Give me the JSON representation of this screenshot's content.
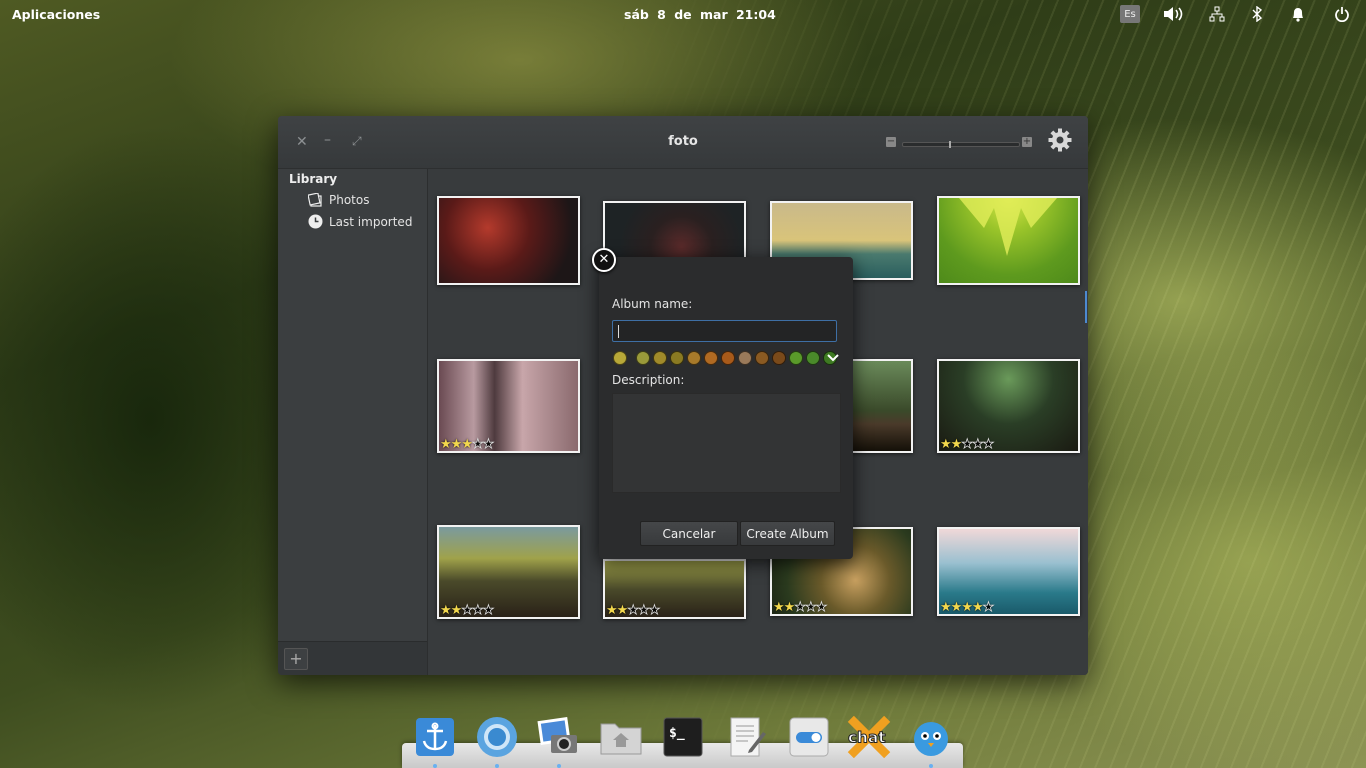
{
  "panel": {
    "applications": "Aplicaciones",
    "clock": "sáb  8 de mar   21:04",
    "lang": "Es",
    "indicators": [
      "volume-icon",
      "network-icon",
      "bluetooth-icon",
      "notifications-icon",
      "power-icon"
    ]
  },
  "window": {
    "title": "foto",
    "controls": [
      "close-icon",
      "minimize-icon",
      "maximize-icon"
    ],
    "zoom_minus": "−",
    "zoom_plus": "+",
    "zoom_level": 0.4
  },
  "sidebar": {
    "heading": "Library",
    "items": [
      {
        "label": "Photos",
        "icon": "photos-icon"
      },
      {
        "label": "Last imported",
        "icon": "clock-icon"
      }
    ],
    "add_button": "+"
  },
  "photos": [
    {
      "name": "photo-red-bokeh",
      "rating": 0
    },
    {
      "name": "photo-dark-rose",
      "rating": 0
    },
    {
      "name": "photo-sunset-sea",
      "rating": 0
    },
    {
      "name": "photo-green-leaf",
      "rating": 0
    },
    {
      "name": "photo-forest-bench",
      "rating": 3
    },
    {
      "name": "photo-blur-2",
      "rating": 0
    },
    {
      "name": "photo-blur-3",
      "rating": 0
    },
    {
      "name": "photo-branch-1",
      "rating": 2
    },
    {
      "name": "photo-branch-2",
      "rating": 2
    },
    {
      "name": "photo-branch-3",
      "rating": 2
    },
    {
      "name": "photo-path",
      "rating": 2
    },
    {
      "name": "photo-water-drops",
      "rating": 4
    }
  ],
  "dialog": {
    "album_name_label": "Album name:",
    "album_name_value": "",
    "description_label": "Description:",
    "description_value": "",
    "cancel": "Cancelar",
    "create": "Create Album",
    "colors": [
      "#b8a838",
      "#9a9a3a",
      "#a08a2a",
      "#8a7a22",
      "#a87a2a",
      "#b06a22",
      "#a85a1a",
      "#9a7a5a",
      "#8a5a22",
      "#7a4a1a",
      "#5a9a2a",
      "#4a8a2a",
      "#3e7a22"
    ]
  },
  "dock": [
    {
      "name": "dock-anchor-icon"
    },
    {
      "name": "dock-chromium-icon"
    },
    {
      "name": "dock-foto-icon"
    },
    {
      "name": "dock-files-icon"
    },
    {
      "name": "dock-terminal-icon"
    },
    {
      "name": "dock-editor-icon"
    },
    {
      "name": "dock-settings-icon"
    },
    {
      "name": "dock-chat-icon"
    },
    {
      "name": "dock-twitter-icon"
    }
  ],
  "dock_terminal_text": "$_",
  "dock_chat_text": "chat"
}
